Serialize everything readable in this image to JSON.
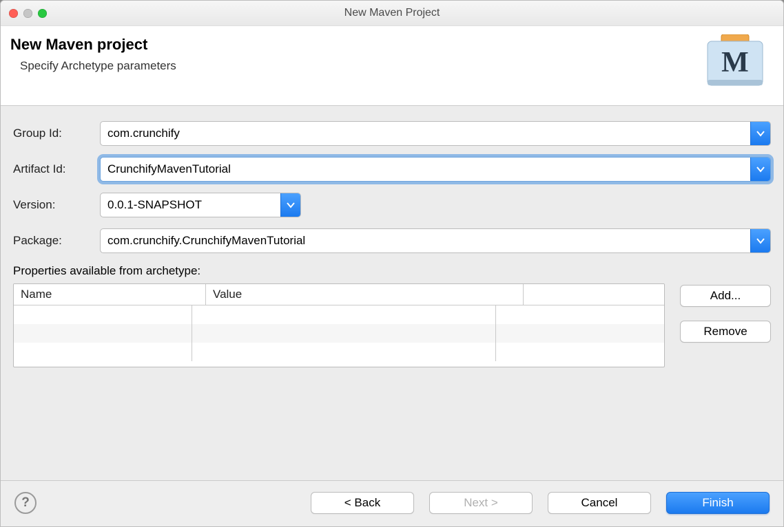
{
  "window": {
    "title": "New Maven Project"
  },
  "banner": {
    "title": "New Maven project",
    "subtitle": "Specify Archetype parameters"
  },
  "fields": {
    "groupId": {
      "label": "Group Id:",
      "value": "com.crunchify"
    },
    "artifactId": {
      "label": "Artifact Id:",
      "value": "CrunchifyMavenTutorial",
      "focused": true
    },
    "version": {
      "label": "Version:",
      "value": "0.0.1-SNAPSHOT"
    },
    "package": {
      "label": "Package:",
      "value": "com.crunchify.CrunchifyMavenTutorial"
    }
  },
  "properties": {
    "label": "Properties available from archetype:",
    "columns": {
      "name": "Name",
      "value": "Value"
    },
    "buttons": {
      "add": "Add...",
      "remove": "Remove"
    }
  },
  "footer": {
    "back": "< Back",
    "next": "Next >",
    "cancel": "Cancel",
    "finish": "Finish",
    "nextEnabled": false
  },
  "colors": {
    "accent": "#2b87f5",
    "focus": "#8fb9e6"
  }
}
